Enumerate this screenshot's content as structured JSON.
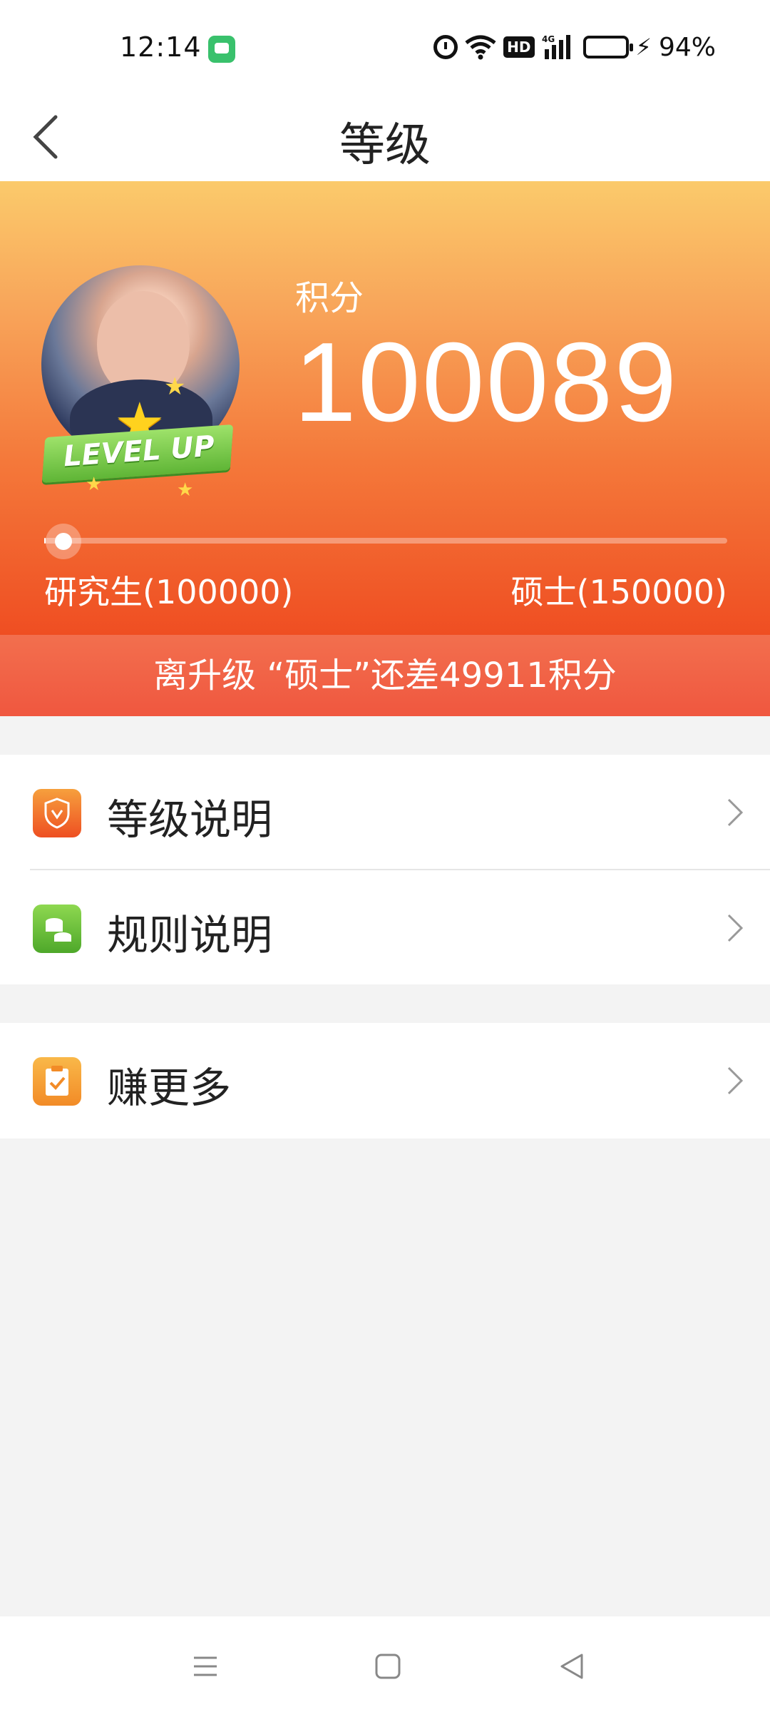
{
  "status_bar": {
    "time": "12:14",
    "hd_label": "HD",
    "battery_percent": "94%",
    "icons": [
      "message-app-icon",
      "alarm-icon",
      "wifi-icon",
      "hd-icon",
      "signal-4g-icon",
      "battery-icon",
      "charging-bolt-icon"
    ]
  },
  "header": {
    "title": "等级",
    "back_icon": "chevron-left-icon"
  },
  "hero": {
    "points_label": "积分",
    "points_value": "100089",
    "badge_text": "LEVEL UP",
    "progress_fraction": 0.0018,
    "current_level": "研究生(100000)",
    "next_level": "硕士(150000)",
    "upgrade_text": "离升级 “硕士”还差49911积分",
    "colors": {
      "gradient_top": "#fbca6b",
      "gradient_bottom": "#ef4e22",
      "banner": "#f0573f"
    }
  },
  "menu": {
    "group1": [
      {
        "label": "等级说明",
        "icon": "shield-icon"
      },
      {
        "label": "规则说明",
        "icon": "coins-icon"
      }
    ],
    "group2": [
      {
        "label": "赚更多",
        "icon": "clipboard-check-icon"
      }
    ]
  },
  "nav": {
    "icons": [
      "menu-icon",
      "home-square-icon",
      "back-triangle-icon"
    ]
  }
}
